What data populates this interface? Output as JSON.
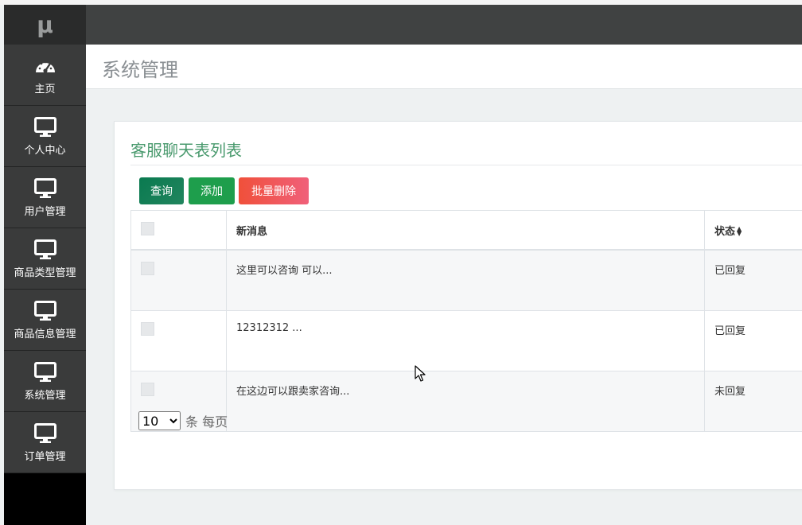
{
  "sidebar": {
    "brand": "μ",
    "items": [
      {
        "label": "主页",
        "icon": "dashboard-gauge-icon"
      },
      {
        "label": "个人中心",
        "icon": "monitor-icon"
      },
      {
        "label": "用户管理",
        "icon": "monitor-icon"
      },
      {
        "label": "商品类型管理",
        "icon": "monitor-icon"
      },
      {
        "label": "商品信息管理",
        "icon": "monitor-icon"
      },
      {
        "label": "系统管理",
        "icon": "monitor-icon"
      },
      {
        "label": "订单管理",
        "icon": "monitor-icon"
      }
    ]
  },
  "header": {
    "title": "系统管理"
  },
  "card": {
    "title": "客服聊天表列表",
    "buttons": {
      "query": "查询",
      "add": "添加",
      "batch_delete": "批量删除"
    },
    "table": {
      "columns": {
        "message": "新消息",
        "status": "状态",
        "status_sort_icon": "sort-updown-icon"
      },
      "rows": [
        {
          "message": "这里可以咨询 可以...",
          "status": "已回复"
        },
        {
          "message": "12312312 ...",
          "status": "已回复"
        },
        {
          "message": "在这边可以跟卖家咨询...",
          "status": "未回复"
        }
      ]
    },
    "pagination": {
      "page_size": "10",
      "unit_label": "条 每页"
    }
  },
  "colors": {
    "sidebar_bg": "#3a3b3b",
    "topbar_bg": "#404242",
    "title_green": "#4a9a6e",
    "query_button": "#0a7a50",
    "add_button": "#1e9e4c",
    "batch_delete_button": "#f0503a"
  }
}
